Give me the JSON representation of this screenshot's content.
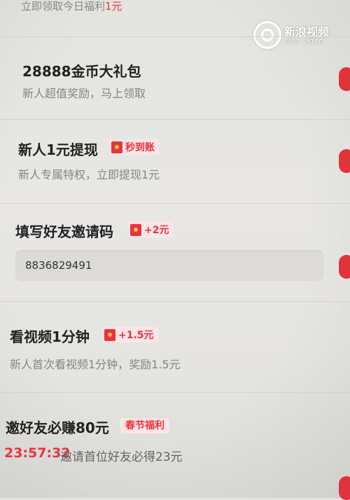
{
  "top_partial": {
    "text": "立即领取今日福利",
    "amount": "1元"
  },
  "watermark": {
    "cn": "新浪视频",
    "en": "sina video"
  },
  "tasks": [
    {
      "title": "28888金币大礼包",
      "desc": "新人超值奖励，马上领取"
    },
    {
      "title": "新人1元提现",
      "tag": "秒到账",
      "desc": "新人专属特权，立即提现1元"
    },
    {
      "title": "填写好友邀请码",
      "tag": "+2元",
      "input_value": "8836829491"
    },
    {
      "title": "看视频1分钟",
      "tag": "+1.5元",
      "desc": "新人首次看视频1分钟，奖励1.5元"
    },
    {
      "title": "邀好友必赚80元",
      "tag": "春节福利",
      "timer": "23:57:32",
      "desc": "邀请首位好友必得23元"
    }
  ],
  "colors": {
    "accent": "#e8343f",
    "tag_bg": "#fce5e8",
    "background": "#e6e5e2"
  }
}
